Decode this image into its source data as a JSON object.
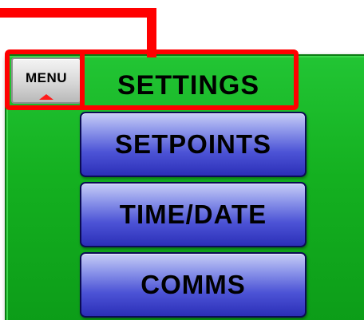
{
  "menu": {
    "label": "MENU"
  },
  "screen": {
    "title": "SETTINGS"
  },
  "buttons": [
    {
      "label": "SETPOINTS"
    },
    {
      "label": "TIME/DATE"
    },
    {
      "label": "COMMS"
    }
  ],
  "colors": {
    "panel": "#14b020",
    "button": "#4d54d6",
    "highlight": "#ff0000"
  },
  "icons": {
    "menu_indicator": "up-arrow-icon"
  }
}
